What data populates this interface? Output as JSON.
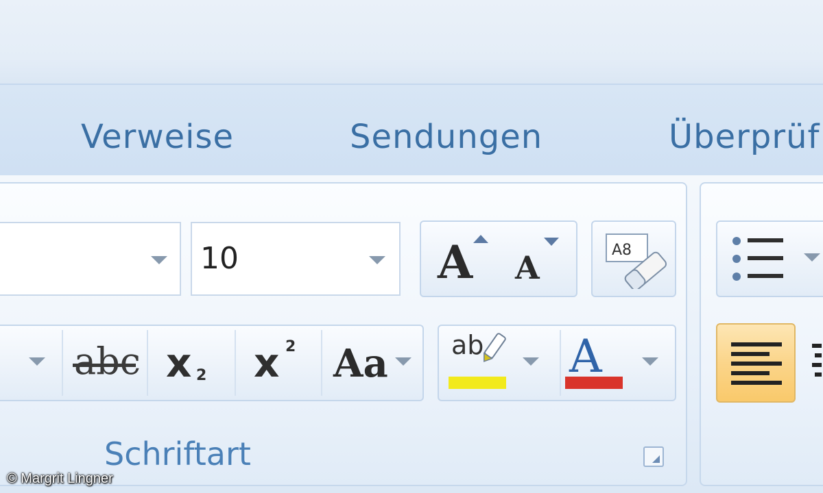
{
  "tabs": {
    "verweise": "Verweise",
    "sendungen": "Sendungen",
    "ueberpruefen": "Überprüf"
  },
  "font_group": {
    "label": "Schriftart",
    "font_name_value": "",
    "font_size_value": "10",
    "grow_glyph": "A",
    "shrink_glyph": "A",
    "clear_format_glyph": "A8",
    "strike_glyph": "abc",
    "subscript_glyph": "x",
    "subscript_mark": "2",
    "superscript_glyph": "x",
    "superscript_mark": "2",
    "change_case_glyph": "Aa",
    "highlight_glyph": "ab",
    "font_color_glyph": "A"
  },
  "colors": {
    "tab_text": "#3a6fa4",
    "group_label": "#4a80b7",
    "highlight": "#f2ea1c",
    "font_color": "#d9342b",
    "active_button": "#fbd58a"
  },
  "icons": {
    "dropdown": "chevron-down-icon",
    "bullets": "bullet-list-icon",
    "align_left": "align-left-icon"
  },
  "watermark": "© Margrit Lingner"
}
